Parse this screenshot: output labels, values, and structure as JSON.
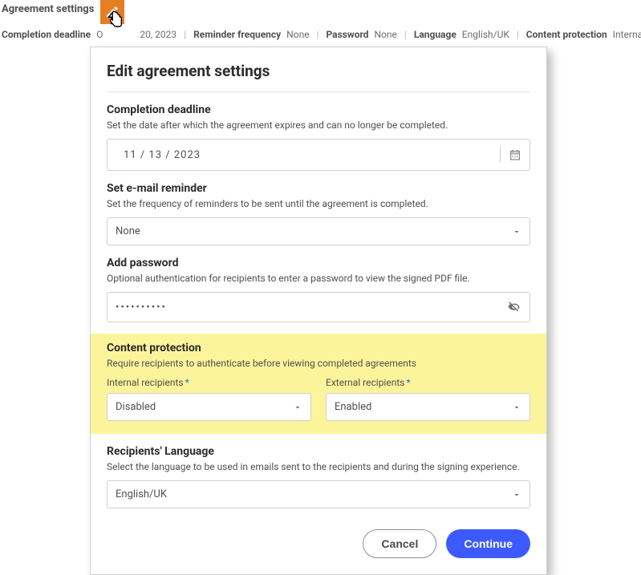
{
  "header": {
    "title": "Agreement settings"
  },
  "summary": {
    "deadline_label": "Completion deadline",
    "deadline_value": "20, 2023",
    "deadline_prefix": "O",
    "reminder_label": "Reminder frequency",
    "reminder_value": "None",
    "password_label": "Password",
    "password_value": "None",
    "language_label": "Language",
    "language_value": "English/UK",
    "protection_label": "Content protection",
    "protection_value": "Internal disabled & External enabled"
  },
  "modal": {
    "title": "Edit agreement settings",
    "deadline": {
      "title": "Completion deadline",
      "desc": "Set the date after which the agreement expires and can no longer be completed.",
      "value": "11 /  13 /  2023"
    },
    "reminder": {
      "title": "Set e-mail reminder",
      "desc": "Set the frequency of reminders to be sent until the agreement is completed.",
      "value": "None"
    },
    "password": {
      "title": "Add password",
      "desc": "Optional authentication for recipients to enter a password to view the signed PDF file.",
      "value": "••••••••••"
    },
    "protection": {
      "title": "Content protection",
      "desc": "Require recipients to authenticate before viewing completed agreements",
      "internal_label": "Internal recipients",
      "internal_value": "Disabled",
      "external_label": "External recipients",
      "external_value": "Enabled"
    },
    "language": {
      "title": "Recipients' Language",
      "desc": "Select the language to be used in emails sent to the recipients and during the signing experience.",
      "value": "English/UK"
    },
    "cancel": "Cancel",
    "continue": "Continue"
  }
}
